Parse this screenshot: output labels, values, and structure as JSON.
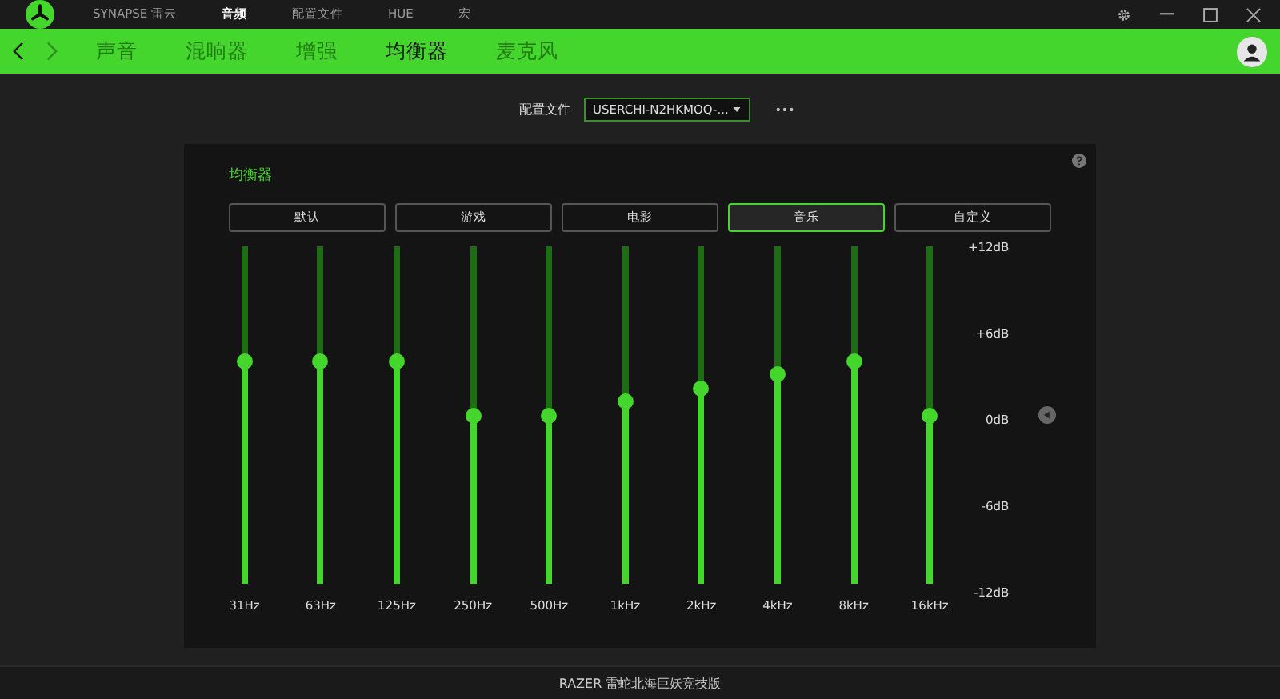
{
  "top_nav": [
    {
      "label": "SYNAPSE 雷云",
      "selected": false
    },
    {
      "label": "音频",
      "selected": true
    },
    {
      "label": "配置文件",
      "selected": false
    },
    {
      "label": "HUE",
      "selected": false
    },
    {
      "label": "宏",
      "selected": false
    }
  ],
  "tabs": [
    {
      "label": "声音",
      "selected": false
    },
    {
      "label": "混响器",
      "selected": false
    },
    {
      "label": "增强",
      "selected": false
    },
    {
      "label": "均衡器",
      "selected": true
    },
    {
      "label": "麦克风",
      "selected": false
    }
  ],
  "profile": {
    "label": "配置文件",
    "value": "USERCHI-N2HKMOQ-..."
  },
  "equalizer": {
    "title": "均衡器",
    "presets": [
      {
        "label": "默认",
        "selected": false
      },
      {
        "label": "游戏",
        "selected": false
      },
      {
        "label": "电影",
        "selected": false
      },
      {
        "label": "音乐",
        "selected": true
      },
      {
        "label": "自定义",
        "selected": false
      }
    ],
    "bands": [
      {
        "label": "31Hz",
        "level": 0.66
      },
      {
        "label": "63Hz",
        "level": 0.66
      },
      {
        "label": "125Hz",
        "level": 0.66
      },
      {
        "label": "250Hz",
        "level": 0.5
      },
      {
        "label": "500Hz",
        "level": 0.5
      },
      {
        "label": "1kHz",
        "level": 0.54
      },
      {
        "label": "2kHz",
        "level": 0.58
      },
      {
        "label": "4kHz",
        "level": 0.62
      },
      {
        "label": "8kHz",
        "level": 0.66
      },
      {
        "label": "16kHz",
        "level": 0.5
      }
    ],
    "scale": [
      "+12dB",
      "+6dB",
      "0dB",
      "-6dB",
      "-12dB"
    ]
  },
  "footer": "RAZER 雷蛇北海巨妖竞技版"
}
